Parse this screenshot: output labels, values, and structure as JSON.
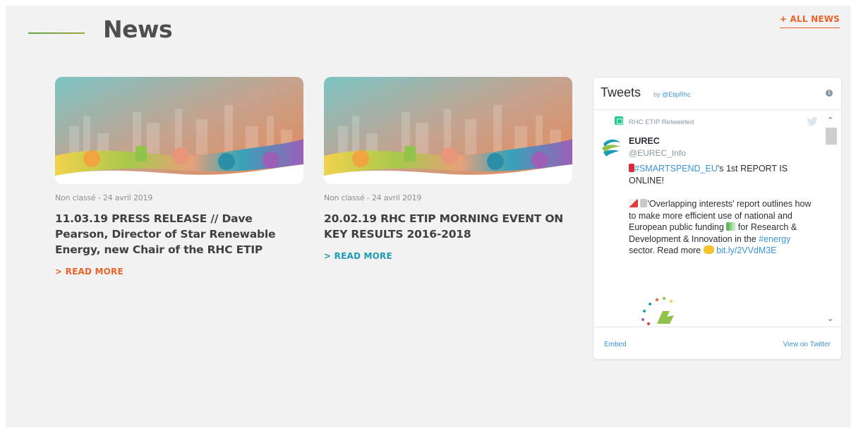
{
  "header": {
    "title": "News",
    "all_news_label": "+ ALL NEWS"
  },
  "articles": [
    {
      "meta": "Non classé - 24 avril 2019",
      "title": "11.03.19 PRESS RELEASE // Dave Pearson, Director of Star Renewable Energy, new Chair of the RHC ETIP",
      "read_more": "> READ MORE",
      "read_more_color": "#e8622a"
    },
    {
      "meta": "Non classé - 24 avril 2019",
      "title": "20.02.19 RHC ETIP MORNING EVENT ON KEY RESULTS 2016-2018",
      "read_more": "> READ MORE",
      "read_more_color": "#1e9bb5"
    }
  ],
  "twitter": {
    "title": "Tweets",
    "by_prefix": "by",
    "by_handle": "@EtipRhc",
    "retweeted_label": "RHC ETIP Retweeted",
    "author_name": "EUREC",
    "author_handle": "@EUREC_Info",
    "tweet": {
      "hashtag_1": "#SMARTSPEND_EU",
      "line_1_rest": "'s 1st REPORT IS ONLINE!",
      "para_2_a": "'Overlapping interests' report outlines how  to make more efficient use of national and European public funding",
      "para_2_b": "for Research & Development & Innovation in the",
      "hashtag_2": "#energy",
      "para_2_c": "sector. Read more",
      "link": "bit.ly/2VVdM3E"
    },
    "embed_label": "Embed",
    "view_label": "View on Twitter"
  },
  "colors": {
    "accent_orange": "#e8622a",
    "accent_teal": "#1e9bb5",
    "twitter_blue": "#3b94d9",
    "retweet_green": "#19cf86"
  },
  "icons": [
    "retweet-icon",
    "twitter-bird-icon",
    "info-icon",
    "scroll-up-icon",
    "scroll-down-icon",
    "megaphone-emoji",
    "document-emoji",
    "chart-emoji",
    "bars-emoji",
    "pointing-hand-emoji"
  ]
}
